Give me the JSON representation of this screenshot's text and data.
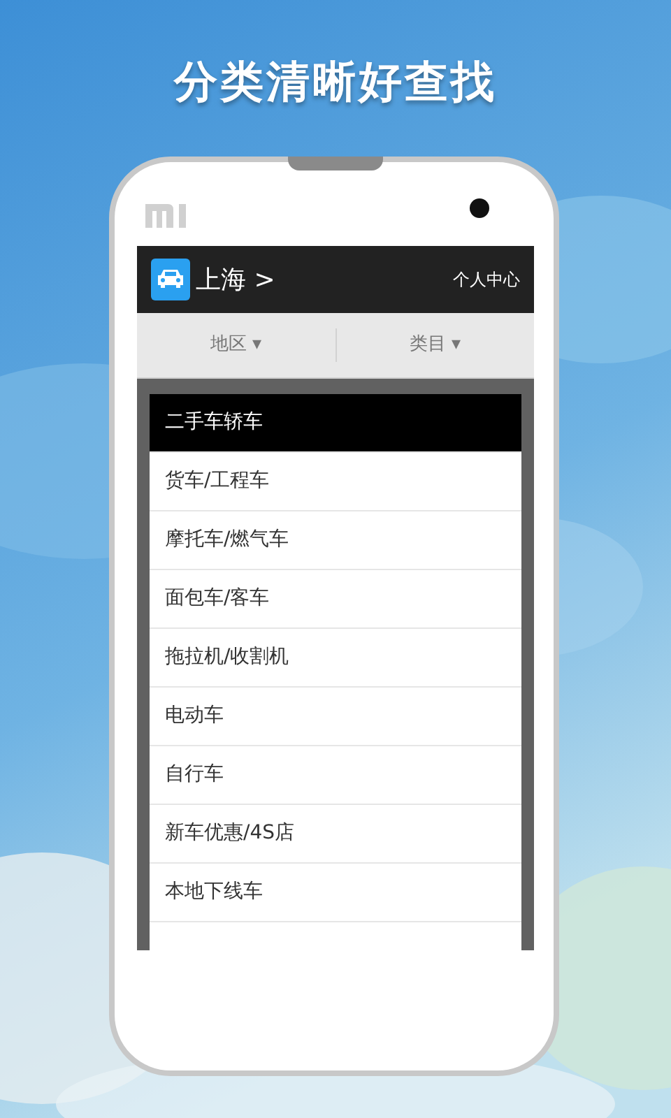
{
  "banner": {
    "title": "分类清晰好查找"
  },
  "header": {
    "city": "上海",
    "chevron": ">",
    "account": "个人中心"
  },
  "filters": [
    {
      "label": "地区",
      "caret": "▾"
    },
    {
      "label": "类目",
      "caret": "▾"
    }
  ],
  "categories": [
    {
      "label": "二手车轿车",
      "selected": true
    },
    {
      "label": "货车/工程车",
      "selected": false
    },
    {
      "label": "摩托车/燃气车",
      "selected": false
    },
    {
      "label": "面包车/客车",
      "selected": false
    },
    {
      "label": "拖拉机/收割机",
      "selected": false
    },
    {
      "label": "电动车",
      "selected": false
    },
    {
      "label": "自行车",
      "selected": false
    },
    {
      "label": "新车优惠/4S店",
      "selected": false
    },
    {
      "label": "本地下线车",
      "selected": false
    }
  ]
}
